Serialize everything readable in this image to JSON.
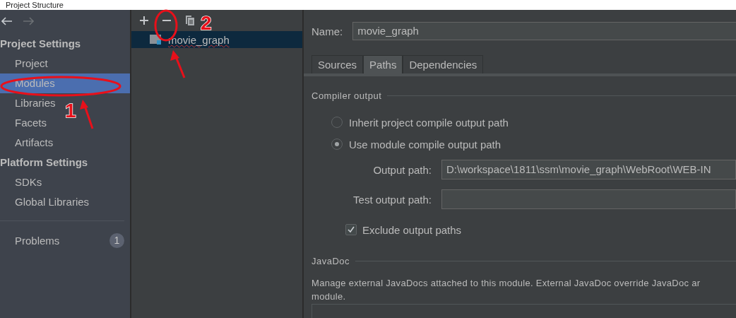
{
  "window": {
    "title": "Project Structure"
  },
  "sidebar": {
    "sections": [
      {
        "title": "Project Settings",
        "items": [
          {
            "label": "Project",
            "selected": false
          },
          {
            "label": "Modules",
            "selected": true
          },
          {
            "label": "Libraries",
            "selected": false
          },
          {
            "label": "Facets",
            "selected": false
          },
          {
            "label": "Artifacts",
            "selected": false
          }
        ]
      },
      {
        "title": "Platform Settings",
        "items": [
          {
            "label": "SDKs",
            "selected": false
          },
          {
            "label": "Global Libraries",
            "selected": false
          }
        ]
      }
    ],
    "problems": {
      "label": "Problems",
      "count": "1"
    }
  },
  "modules": {
    "items": [
      {
        "label": "movie_graph",
        "selected": true
      }
    ]
  },
  "details": {
    "name_label": "Name:",
    "name_value": "movie_graph",
    "tabs": [
      {
        "label": "Sources",
        "selected": false
      },
      {
        "label": "Paths",
        "selected": true
      },
      {
        "label": "Dependencies",
        "selected": false
      }
    ],
    "compiler_output": {
      "title": "Compiler output",
      "options": [
        {
          "label": "Inherit project compile output path",
          "selected": false
        },
        {
          "label": "Use module compile output path",
          "selected": true
        }
      ],
      "output_path_label": "Output path:",
      "output_path": "D:\\workspace\\1811\\ssm\\movie_graph\\WebRoot\\WEB-IN",
      "test_output_path_label": "Test output path:",
      "exclude": {
        "label": "Exclude output paths",
        "checked": true
      }
    },
    "javadoc": {
      "title": "JavaDoc",
      "description_lines": [
        "Manage external JavaDocs attached to this module. External JavaDoc override JavaDoc ar",
        "module."
      ]
    }
  },
  "annotations": [
    {
      "label": "1"
    },
    {
      "label": "2"
    }
  ]
}
